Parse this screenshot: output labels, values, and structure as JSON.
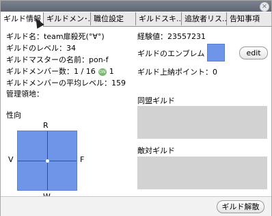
{
  "window": {
    "close_label": "×"
  },
  "tabs": [
    {
      "label": "ギルド情報",
      "active": true
    },
    {
      "label": "ギルドメン･..."
    },
    {
      "label": "職位設定"
    },
    {
      "label": "ギルドスキ..."
    },
    {
      "label": "追放者リス..."
    },
    {
      "label": "告知事項"
    }
  ],
  "info": {
    "guild_name": "ギルド名：team扉殺死(°∀°)",
    "guild_level": "ギルドのレベル：34",
    "master_name": "ギルドマスターの名前：pon-f",
    "members": "ギルドメンバー数：1 / 16",
    "online_badge": "ON",
    "online_count": "1",
    "avg_level": "ギルドメンバーの平均レベル：159",
    "territory": "管理領地："
  },
  "right": {
    "exp": "経験値：23557231",
    "emblem_label": "ギルドのエンブレム",
    "edit_label": "edit",
    "points": "ギルド上納ポイント：0",
    "alliance_label": "同盟ギルド",
    "enemy_label": "敵対ギルド"
  },
  "tendency": {
    "title": "性向",
    "top": "R",
    "bottom": "W",
    "left": "V",
    "right": "F"
  },
  "footer": {
    "dissolve_label": "ギルド解散"
  }
}
